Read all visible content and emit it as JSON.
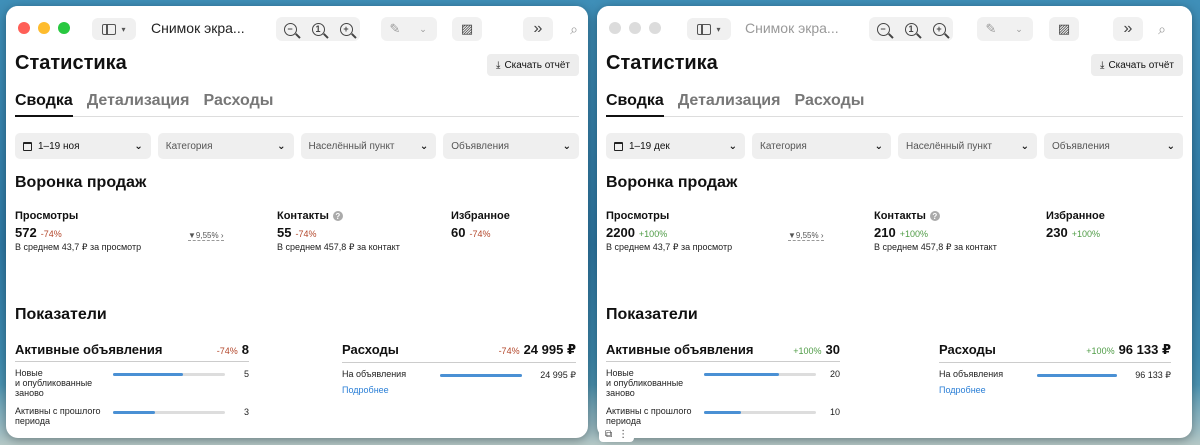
{
  "colors": {
    "close": "#ff5f57",
    "minimize": "#febc2e",
    "zoom": "#28c840",
    "inactive": "#dcdcdc",
    "negative": "#b3472b",
    "positive": "#4f9c46",
    "bar": "#4a90d4",
    "link": "#2b7fd6"
  },
  "windows": [
    {
      "title_bar": {
        "title": "Снимок экра...",
        "active": true
      },
      "page_title": "Статистика",
      "download_label": "Скачать отчёт",
      "tabs": [
        "Сводка",
        "Детализация",
        "Расходы"
      ],
      "filters": {
        "date": "1–19 ноя",
        "category": "Категория",
        "city": "Населённый пункт",
        "ads": "Объявления"
      },
      "funnel": {
        "title": "Воронка продаж",
        "views": {
          "label": "Просмотры",
          "value": "572",
          "change": "-74%",
          "sub": "В среднем 43,7 ₽ за просмотр"
        },
        "conversion": "9,55%",
        "contacts": {
          "label": "Контакты",
          "value": "55",
          "change": "-74%",
          "sub": "В среднем 457,8 ₽ за контакт"
        },
        "favorites": {
          "label": "Избранное",
          "value": "60",
          "change": "-74%"
        }
      },
      "indicators": {
        "title": "Показатели",
        "active_ads": {
          "title": "Активные объявления",
          "change": "-74%",
          "value": "8",
          "rows": [
            {
              "label": "Новые\nи опубликованные\nзаново",
              "value": "5",
              "fraction": 0.625
            },
            {
              "label": "Активны с прошлого\nпериода",
              "value": "3",
              "fraction": 0.375
            }
          ]
        },
        "expenses": {
          "title": "Расходы",
          "change": "-74%",
          "value": "24 995 ₽",
          "rows": [
            {
              "label": "На объявления",
              "value": "24 995 ₽",
              "fraction": 1.0
            }
          ],
          "more": "Подробнее"
        }
      }
    },
    {
      "title_bar": {
        "title": "Снимок экра...",
        "active": false
      },
      "page_title": "Статистика",
      "download_label": "Скачать отчёт",
      "tabs": [
        "Сводка",
        "Детализация",
        "Расходы"
      ],
      "filters": {
        "date": "1–19 дек",
        "category": "Категория",
        "city": "Населённый пункт",
        "ads": "Объявления"
      },
      "funnel": {
        "title": "Воронка продаж",
        "views": {
          "label": "Просмотры",
          "value": "2200",
          "change": "+100%",
          "sub": "В среднем 43,7 ₽ за просмотр"
        },
        "conversion": "9,55%",
        "contacts": {
          "label": "Контакты",
          "value": "210",
          "change": "+100%",
          "sub": "В среднем 457,8 ₽ за контакт"
        },
        "favorites": {
          "label": "Избранное",
          "value": "230",
          "change": "+100%"
        }
      },
      "indicators": {
        "title": "Показатели",
        "active_ads": {
          "title": "Активные объявления",
          "change": "+100%",
          "value": "30",
          "rows": [
            {
              "label": "Новые\nи опубликованные\nзаново",
              "value": "20",
              "fraction": 0.667
            },
            {
              "label": "Активны с прошлого\nпериода",
              "value": "10",
              "fraction": 0.333
            }
          ]
        },
        "expenses": {
          "title": "Расходы",
          "change": "+100%",
          "value": "96 133 ₽",
          "rows": [
            {
              "label": "На объявления",
              "value": "96 133 ₽",
              "fraction": 1.0
            }
          ],
          "more": "Подробнее"
        }
      }
    }
  ]
}
